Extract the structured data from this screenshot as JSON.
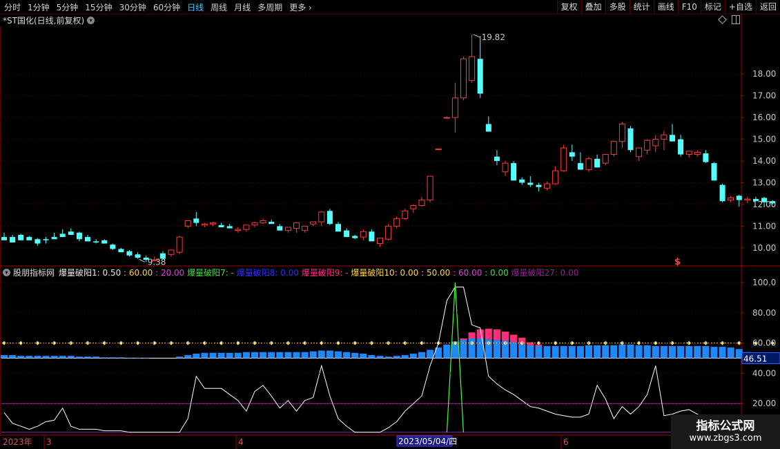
{
  "toolbar": {
    "periods": [
      "分时",
      "1分钟",
      "5分钟",
      "15分钟",
      "30分钟",
      "60分钟",
      "日线",
      "周线",
      "月线",
      "多周期",
      "更多"
    ],
    "active_period": "日线",
    "right_buttons": [
      "复权",
      "叠加",
      "多股",
      "统计",
      "画线",
      "F10",
      "标记",
      "+自选",
      "返回"
    ]
  },
  "stock_title": "*ST国化(日线,前复权)",
  "price_axis": {
    "ticks": [
      "18.00",
      "17.00",
      "16.00",
      "15.00",
      "14.00",
      "13.00",
      "12.00",
      "11.00",
      "10.00"
    ]
  },
  "annotations": {
    "high_label": "19.82",
    "low_label": "9.38",
    "signal_mark": "$"
  },
  "indicator": {
    "name": "股朋指标网",
    "legend": [
      {
        "text": "爆量破阳1: 0.50",
        "color": "#e8e8e8"
      },
      {
        "text": " : 60.00",
        "color": "#ffd54a"
      },
      {
        "text": " : 20.00",
        "color": "#e040e0"
      },
      {
        "text": " 爆量破阳7: -",
        "color": "#40e040"
      },
      {
        "text": " 爆量破阳8: 0.00",
        "color": "#3030ff"
      },
      {
        "text": " 爆量破阳9: -",
        "color": "#ff3080"
      },
      {
        "text": " 爆量破阳10: 0.00",
        "color": "#ffd54a"
      },
      {
        "text": " : 50.00",
        "color": "#ffd54a"
      },
      {
        "text": " : 60.00",
        "color": "#e040e0"
      },
      {
        "text": " : 0.00",
        "color": "#40e040"
      },
      {
        "text": " 爆量破阳27: 0.00",
        "color": "#8a2a8a"
      }
    ],
    "axis_ticks": [
      "100.0",
      "80.00",
      "60.00",
      "40.00",
      "20.00"
    ],
    "current_value": "46.51"
  },
  "date_axis": {
    "year": "2023年",
    "months": [
      "3",
      "4",
      "6"
    ],
    "cursor_date": "2023/05/04/四"
  },
  "watermark": {
    "title": "指标公式网",
    "url": "www.zbgs3.com"
  },
  "colors": {
    "up": "#ff3c3c",
    "down": "#54ffff",
    "grid": "#6b0000",
    "blue_bar": "#1e88ff",
    "pink_bar": "#ff2d7a"
  },
  "chart_data": {
    "type": "candlestick",
    "candles": [
      [
        10.5,
        10.7,
        10.4,
        10.35
      ],
      [
        10.5,
        10.6,
        10.4,
        10.25
      ],
      [
        10.6,
        10.65,
        10.4,
        10.35
      ],
      [
        10.5,
        10.55,
        10.35,
        10.35
      ],
      [
        10.4,
        10.45,
        10.1,
        10.2
      ],
      [
        10.4,
        10.5,
        10.2,
        10.35
      ],
      [
        10.5,
        10.7,
        10.4,
        10.4
      ],
      [
        10.65,
        10.85,
        10.5,
        10.5
      ],
      [
        10.75,
        10.9,
        10.6,
        10.6
      ],
      [
        10.7,
        10.75,
        10.3,
        10.4
      ],
      [
        10.5,
        10.6,
        10.3,
        10.3
      ],
      [
        10.3,
        10.4,
        10.2,
        10.25
      ],
      [
        10.35,
        10.4,
        10.2,
        10.2
      ],
      [
        10.15,
        10.2,
        9.9,
        9.95
      ],
      [
        9.95,
        10.0,
        9.8,
        9.8
      ],
      [
        9.85,
        9.9,
        9.6,
        9.65
      ],
      [
        9.7,
        9.8,
        9.5,
        9.55
      ],
      [
        9.55,
        9.65,
        9.35,
        9.45
      ],
      [
        9.45,
        9.6,
        9.38,
        9.45
      ],
      [
        9.75,
        9.85,
        9.5,
        9.5
      ],
      [
        9.7,
        9.9,
        9.6,
        9.9
      ],
      [
        9.8,
        10.55,
        9.7,
        10.5
      ],
      [
        11.0,
        11.25,
        10.9,
        11.25
      ],
      [
        11.35,
        11.65,
        11.0,
        11.15
      ],
      [
        11.05,
        11.15,
        10.95,
        11.1
      ],
      [
        11.1,
        11.2,
        11.0,
        11.15
      ],
      [
        11.05,
        11.15,
        10.95,
        10.95
      ],
      [
        11.0,
        11.1,
        10.9,
        10.9
      ],
      [
        10.8,
        10.95,
        10.7,
        10.85
      ],
      [
        10.85,
        11.05,
        10.75,
        11.05
      ],
      [
        11.05,
        11.2,
        10.95,
        11.15
      ],
      [
        11.15,
        11.35,
        11.1,
        11.25
      ],
      [
        11.2,
        11.3,
        11.1,
        11.1
      ],
      [
        11.0,
        11.1,
        10.8,
        10.8
      ],
      [
        10.8,
        10.95,
        10.7,
        10.95
      ],
      [
        10.9,
        11.2,
        10.7,
        11.15
      ],
      [
        10.8,
        11.0,
        10.7,
        11.0
      ],
      [
        11.1,
        11.2,
        11.0,
        11.2
      ],
      [
        11.2,
        11.7,
        11.0,
        11.65
      ],
      [
        11.7,
        11.8,
        11.05,
        11.1
      ],
      [
        11.1,
        11.2,
        10.8,
        10.75
      ],
      [
        10.8,
        10.9,
        10.5,
        10.5
      ],
      [
        10.55,
        10.6,
        10.4,
        10.45
      ],
      [
        10.5,
        10.85,
        10.35,
        10.75
      ],
      [
        10.75,
        10.85,
        10.35,
        10.3
      ],
      [
        10.2,
        10.45,
        10.05,
        10.45
      ],
      [
        10.4,
        11.1,
        10.35,
        11.0
      ],
      [
        11.0,
        11.45,
        10.9,
        11.35
      ],
      [
        11.35,
        11.8,
        11.3,
        11.7
      ],
      [
        11.8,
        12.0,
        11.6,
        11.95
      ],
      [
        11.95,
        12.35,
        11.9,
        12.2
      ],
      [
        12.2,
        13.3,
        12.1,
        13.3
      ],
      [
        14.55,
        14.55,
        14.5,
        14.55
      ],
      [
        16.0,
        16.05,
        15.95,
        16.0
      ],
      [
        16.0,
        17.6,
        15.3,
        16.9
      ],
      [
        16.9,
        18.8,
        16.8,
        18.7
      ],
      [
        17.7,
        19.82,
        17.6,
        18.8
      ],
      [
        18.7,
        19.75,
        16.9,
        17.1
      ],
      [
        15.7,
        16.05,
        15.35,
        15.35
      ],
      [
        14.2,
        14.5,
        13.8,
        14.0
      ],
      [
        13.5,
        14.0,
        13.3,
        13.9
      ],
      [
        13.9,
        14.0,
        13.1,
        13.1
      ],
      [
        13.15,
        13.25,
        12.9,
        13.0
      ],
      [
        13.0,
        13.3,
        12.8,
        12.9
      ],
      [
        12.9,
        13.0,
        12.6,
        12.8
      ],
      [
        12.75,
        13.05,
        12.65,
        12.95
      ],
      [
        12.95,
        13.75,
        12.9,
        13.55
      ],
      [
        13.55,
        14.75,
        13.5,
        14.6
      ],
      [
        14.4,
        14.75,
        14.0,
        14.2
      ],
      [
        13.9,
        14.4,
        13.6,
        13.6
      ],
      [
        13.6,
        14.2,
        13.5,
        14.1
      ],
      [
        14.1,
        14.3,
        13.7,
        13.7
      ],
      [
        13.9,
        14.3,
        13.8,
        14.3
      ],
      [
        14.3,
        14.9,
        14.2,
        14.9
      ],
      [
        14.9,
        15.8,
        14.6,
        15.7
      ],
      [
        15.5,
        15.6,
        14.4,
        14.5
      ],
      [
        14.2,
        14.6,
        14.0,
        14.6
      ],
      [
        14.5,
        15.0,
        14.3,
        14.95
      ],
      [
        14.7,
        15.2,
        14.4,
        15.0
      ],
      [
        15.0,
        15.4,
        14.5,
        15.2
      ],
      [
        15.2,
        15.7,
        14.9,
        14.9
      ],
      [
        15.0,
        15.2,
        14.2,
        14.3
      ],
      [
        14.3,
        14.45,
        14.15,
        14.45
      ],
      [
        14.3,
        14.5,
        14.2,
        14.4
      ],
      [
        14.35,
        14.5,
        13.9,
        13.95
      ],
      [
        13.9,
        13.95,
        13.1,
        13.1
      ],
      [
        12.9,
        12.95,
        12.1,
        12.15
      ],
      [
        12.2,
        12.4,
        12.1,
        12.3
      ],
      [
        12.4,
        12.45,
        11.9,
        12.2
      ],
      [
        12.2,
        12.35,
        12.05,
        12.25
      ],
      [
        12.25,
        12.35,
        12.15,
        12.15
      ],
      [
        12.3,
        12.35,
        11.9,
        12.1
      ],
      [
        12.15,
        12.2,
        12.0,
        12.05
      ]
    ],
    "volume_bars": [
      2,
      2,
      1.5,
      1.5,
      1.5,
      1.5,
      1.5,
      1.5,
      1.5,
      1,
      1,
      1,
      0.5,
      0.5,
      0.5,
      0.3,
      0.3,
      0.3,
      0,
      0,
      0,
      1,
      2,
      3,
      3.5,
      3.5,
      3.5,
      3.5,
      3.5,
      4,
      4,
      4,
      4,
      4,
      4,
      4,
      4,
      4.5,
      5,
      5,
      4.5,
      4,
      3.5,
      3,
      2,
      1.5,
      1,
      1.5,
      2,
      3,
      4,
      5.5,
      7,
      9,
      11,
      12,
      13,
      13,
      12.5,
      12,
      11.5,
      10.5,
      9.5,
      8.5,
      8,
      8,
      8,
      8,
      8,
      8,
      8.5,
      8.5,
      8.5,
      8.5,
      9,
      9,
      8.5,
      8.5,
      8,
      8,
      8,
      8,
      8,
      8,
      8,
      7.5,
      7.5,
      7,
      6,
      4,
      2,
      1,
      0.5,
      0
    ],
    "pink_bars": {
      "start": 55,
      "values": [
        1,
        4,
        6,
        7,
        7,
        6,
        5,
        4,
        2,
        1
      ]
    },
    "white_line": [
      14,
      7,
      5,
      3,
      5,
      8,
      9,
      17,
      5,
      3,
      3,
      3,
      2,
      2,
      2,
      1,
      1,
      1,
      1,
      1,
      1,
      1,
      10,
      38,
      30,
      30,
      30,
      26,
      22,
      15,
      28,
      32,
      25,
      17,
      22,
      15,
      22,
      24,
      45,
      25,
      10,
      5,
      1,
      1,
      1,
      1,
      4,
      8,
      15,
      20,
      25,
      45,
      60,
      88,
      97,
      97,
      72,
      70,
      38,
      33,
      29,
      26,
      22,
      18,
      17,
      15,
      13,
      12,
      11,
      11,
      13,
      32,
      23,
      10,
      18,
      13,
      18,
      26,
      45,
      12,
      13,
      15,
      16,
      13,
      10,
      5,
      5,
      5,
      4,
      3
    ],
    "green_spike": {
      "index": 54,
      "peak": 100
    },
    "yellow_line": 60,
    "white_ref": 50,
    "magenta_ref": 20,
    "ylim_price": [
      9.2,
      20.2
    ],
    "ylim_ind": [
      0,
      105
    ]
  }
}
